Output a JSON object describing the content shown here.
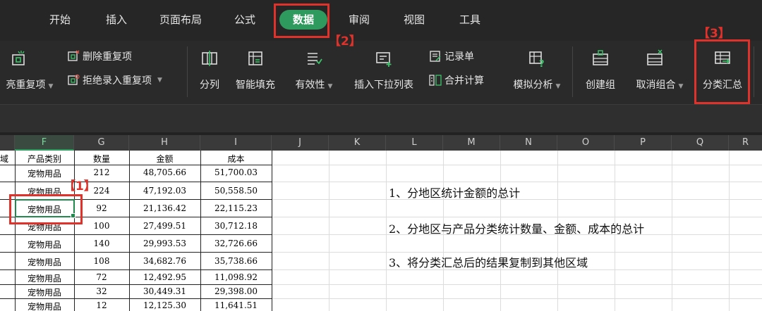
{
  "menu": {
    "tabs": [
      "开始",
      "插入",
      "页面布局",
      "公式",
      "数据",
      "审阅",
      "视图",
      "工具"
    ],
    "active_tab": "数据"
  },
  "ribbon": {
    "highlight_duplicates": "亮重复项",
    "remove_duplicates": "删除重复项",
    "reject_duplicates": "拒绝录入重复项",
    "split_columns": "分列",
    "flash_fill": "智能填充",
    "validation": "有效性",
    "insert_dropdown": "插入下拉列表",
    "record_form": "记录单",
    "consolidate": "合并计算",
    "what_if": "模拟分析",
    "group": "创建组",
    "ungroup": "取消组合",
    "subtotal": "分类汇总"
  },
  "sheet": {
    "columns": [
      "F",
      "G",
      "H",
      "I",
      "J",
      "K",
      "L",
      "M",
      "N",
      "O",
      "P",
      "Q",
      "R"
    ],
    "selected_column": "F",
    "left_partial_header": "域",
    "headers": [
      "产品类别",
      "数量",
      "金额",
      "成本"
    ],
    "rows": [
      [
        "宠物用品",
        "212",
        "48,705.66",
        "51,700.03"
      ],
      [
        "宠物用品",
        "224",
        "47,192.03",
        "50,558.50"
      ],
      [
        "宠物用品",
        "92",
        "21,136.42",
        "22,115.23"
      ],
      [
        "宠物用品",
        "100",
        "27,499.51",
        "30,712.18"
      ],
      [
        "宠物用品",
        "140",
        "29,993.53",
        "32,726.66"
      ],
      [
        "宠物用品",
        "108",
        "34,682.76",
        "35,738.66"
      ],
      [
        "宠物用品",
        "72",
        "12,492.95",
        "11,098.92"
      ],
      [
        "宠物用品",
        "32",
        "30,449.31",
        "29,398.00"
      ],
      [
        "宠物用品",
        "12",
        "12,125.30",
        "11,641.51"
      ]
    ],
    "notes": [
      "1、分地区统计金额的总计",
      "2、分地区与产品分类统计数量、金额、成本的总计",
      "3、将分类汇总后的结果复制到其他区域"
    ]
  },
  "annotations": {
    "step1": "【1】",
    "step2": "【2】",
    "step3": "【3】"
  },
  "colors": {
    "accent": "#2f9a5d",
    "annotation": "#e0312b"
  }
}
